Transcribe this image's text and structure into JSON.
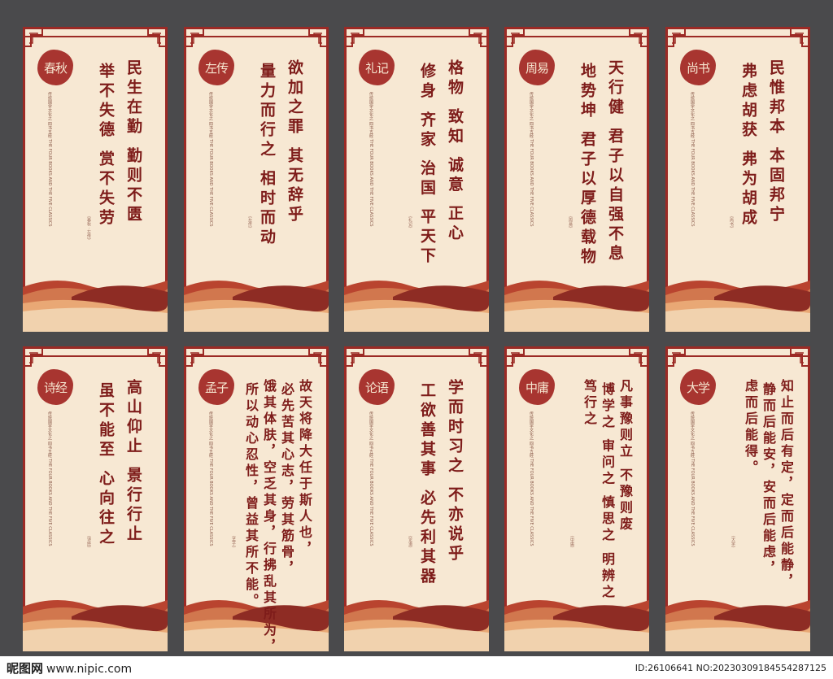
{
  "panels": [
    {
      "seal": "春秋",
      "subtitle": "传统国学文化之 四书五经 THE FOUR BOOKS AND THE FIVE CLASSICS",
      "lines": [
        "民生在勤 勤则不匮",
        "举不失德 赏不失劳"
      ],
      "source": "《春秋 · 左传》"
    },
    {
      "seal": "左传",
      "subtitle": "传统国学文化之 四书五经 THE FOUR BOOKS AND THE FIVE CLASSICS",
      "lines": [
        "欲加之罪 其无辞乎",
        "量力而行之 相时而动"
      ],
      "source": "《左传》"
    },
    {
      "seal": "礼记",
      "subtitle": "传统国学文化之 四书五经 THE FOUR BOOKS AND THE FIVE CLASSICS",
      "lines": [
        "格物 致知 诚意 正心",
        "修身 齐家 治国 平天下"
      ],
      "source": "《礼记》"
    },
    {
      "seal": "周易",
      "subtitle": "传统国学文化之 四书五经 THE FOUR BOOKS AND THE FIVE CLASSICS",
      "lines": [
        "天行健 君子以自强不息",
        "地势坤 君子以厚德载物"
      ],
      "source": "《周易》"
    },
    {
      "seal": "尚书",
      "subtitle": "传统国学文化之 四书五经 THE FOUR BOOKS AND THE FIVE CLASSICS",
      "lines": [
        "民惟邦本 本固邦宁",
        "弗虑胡获 弗为胡成"
      ],
      "source": "《尚书》"
    },
    {
      "seal": "诗经",
      "subtitle": "传统国学文化之 四书五经 THE FOUR BOOKS AND THE FIVE CLASSICS",
      "lines": [
        "高山仰止 景行行止",
        "虽不能至 心向往之"
      ],
      "source": "《诗经》"
    },
    {
      "seal": "孟子",
      "subtitle": "传统国学文化之 四书五经 THE FOUR BOOKS AND THE FIVE CLASSICS",
      "lines": [
        "故天将降大任于斯人也，",
        "必先苦其心志，劳其筋骨，",
        "饿其体肤，空乏其身，行拂乱其所为，",
        "所以动心忍性，曾益其所不能。"
      ],
      "source": "《孟子》"
    },
    {
      "seal": "论语",
      "subtitle": "传统国学文化之 四书五经 THE FOUR BOOKS AND THE FIVE CLASSICS",
      "lines": [
        "学而时习之 不亦说乎",
        "工欲善其事 必先利其器"
      ],
      "source": "《论语》"
    },
    {
      "seal": "中庸",
      "subtitle": "传统国学文化之 四书五经 THE FOUR BOOKS AND THE FIVE CLASSICS",
      "lines": [
        "凡事豫则立 不豫则废",
        "博学之 审问之 慎思之 明辨之",
        "笃行之"
      ],
      "source": "《中庸》"
    },
    {
      "seal": "大学",
      "subtitle": "传统国学文化之 四书五经 THE FOUR BOOKS AND THE FIVE CLASSICS",
      "lines": [
        "知止而后有定，定而后能静，",
        "静而后能安，安而后能虑，",
        "虑而后能得。"
      ],
      "source": "《大学》"
    }
  ],
  "footer": {
    "logo": "昵图网",
    "site": "www.nipic.com",
    "id": "ID:26106641 NO:20230309184554287125"
  },
  "colors": {
    "background": "#4a4a4c",
    "paper": "#f7e8d3",
    "accent": "#9c2a25",
    "ink": "#7e1c1a"
  }
}
